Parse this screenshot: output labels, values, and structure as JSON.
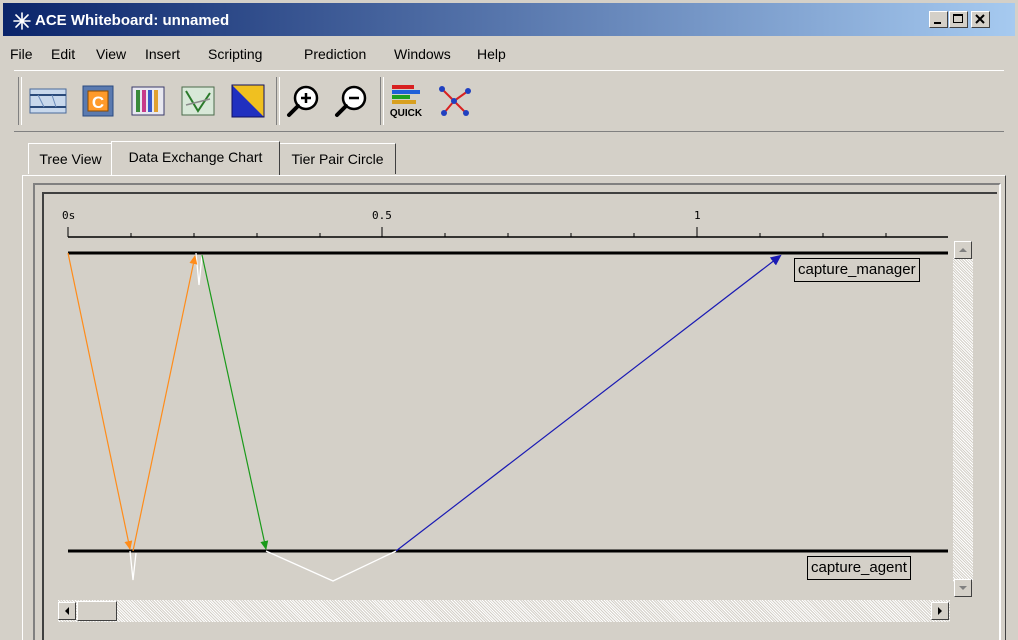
{
  "window": {
    "title": "ACE Whiteboard: unnamed",
    "controls": [
      "minimize",
      "maximize",
      "close"
    ]
  },
  "menu": [
    "File",
    "Edit",
    "View",
    "Insert",
    "Scripting",
    "Prediction",
    "Windows",
    "Help"
  ],
  "toolbar": {
    "tools": [
      {
        "name": "network-view-tool-icon"
      },
      {
        "name": "capture-tool-icon",
        "glyph": "C"
      },
      {
        "name": "table-grid-tool-icon"
      },
      {
        "name": "tier-map-tool-icon"
      },
      {
        "name": "color-triangle-tool-icon"
      },
      {
        "name": "zoom-in-icon"
      },
      {
        "name": "zoom-out-icon"
      },
      {
        "name": "quick-tool-icon",
        "label": "QUICK"
      },
      {
        "name": "node-graph-tool-icon"
      }
    ]
  },
  "tabs": [
    {
      "label": "Tree View",
      "active": false
    },
    {
      "label": "Data Exchange Chart",
      "active": true
    },
    {
      "label": "Tier Pair Circle",
      "active": false
    }
  ],
  "chart_data": {
    "type": "diagram",
    "time_axis": {
      "ticks": [
        "0s",
        "0.5",
        "1"
      ]
    },
    "tiers": [
      {
        "name": "capture_manager"
      },
      {
        "name": "capture_agent"
      }
    ],
    "colors": {
      "orange": "#ff8c1a",
      "green": "#1a9a1a",
      "blue": "#1a1ab4",
      "white": "#ffffff"
    }
  }
}
